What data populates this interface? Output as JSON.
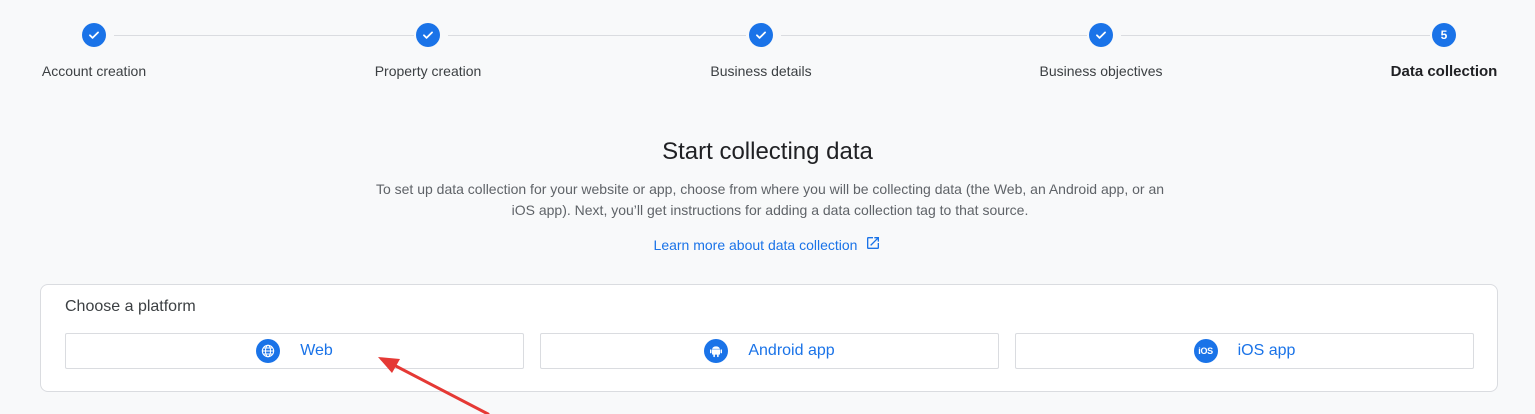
{
  "stepper": {
    "steps": [
      {
        "label": "Account creation",
        "state": "done"
      },
      {
        "label": "Property creation",
        "state": "done"
      },
      {
        "label": "Business details",
        "state": "done"
      },
      {
        "label": "Business objectives",
        "state": "done"
      },
      {
        "label": "Data collection",
        "state": "active",
        "number": "5"
      }
    ]
  },
  "main": {
    "title": "Start collecting data",
    "description": "To set up data collection for your website or app, choose from where you will be collecting data (the Web, an Android app, or an iOS app). Next, you’ll get instructions for adding a data collection tag to that source.",
    "learn_more": "Learn more about data collection"
  },
  "platform_card": {
    "title": "Choose a platform",
    "buttons": [
      {
        "label": "Web",
        "icon": "globe-icon"
      },
      {
        "label": "Android app",
        "icon": "android-icon"
      },
      {
        "label": "iOS app",
        "icon": "ios-icon",
        "glyph": "iOS"
      }
    ]
  },
  "colors": {
    "accent": "#1a73e8",
    "annotation_arrow": "#e53935",
    "background": "#f8f9fa"
  }
}
